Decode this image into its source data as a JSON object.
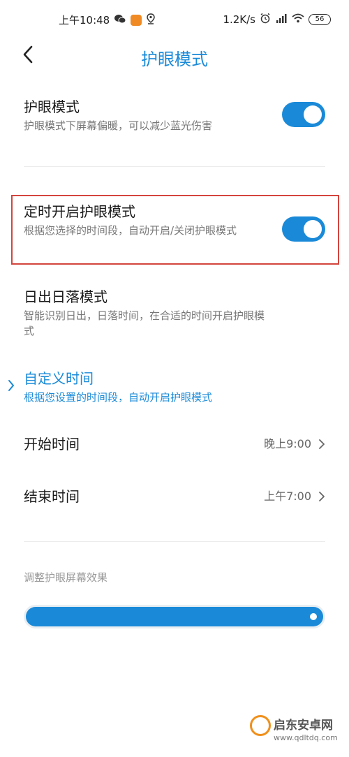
{
  "status_bar": {
    "time": "上午10:48",
    "network_speed": "1.2K/s",
    "battery": "56",
    "icons": [
      "wechat-icon",
      "app-icon",
      "location-icon",
      "alarm-icon",
      "signal-icon",
      "wifi-icon",
      "battery-icon"
    ]
  },
  "header": {
    "title": "护眼模式",
    "back_icon": "chevron-left-icon"
  },
  "eye_care": {
    "title": "护眼模式",
    "desc": "护眼模式下屏幕偏暖，可以减少蓝光伤害",
    "enabled": true
  },
  "schedule": {
    "title": "定时开启护眼模式",
    "desc": "根据您选择的时间段，自动开启/关闭护眼模式",
    "enabled": true
  },
  "sunrise_sunset": {
    "title": "日出日落模式",
    "desc": "智能识别日出，日落时间，在合适的时间开启护眼模式"
  },
  "custom_time": {
    "title": "自定义时间",
    "desc": "根据您设置的时间段，自动开启护眼模式",
    "selected_icon": "chevron-right-icon"
  },
  "start_time": {
    "label": "开始时间",
    "value": "晚上9:00"
  },
  "end_time": {
    "label": "结束时间",
    "value": "上午7:00"
  },
  "effect": {
    "label": "调整护眼屏幕效果",
    "level": 1.0
  },
  "watermark": {
    "name": "启东安卓网",
    "url": "www.qdltdq.com"
  },
  "colors": {
    "accent": "#1a8ad8",
    "highlight_border": "#d3453d",
    "text_primary": "#1a1a1a",
    "text_secondary": "#777777"
  }
}
